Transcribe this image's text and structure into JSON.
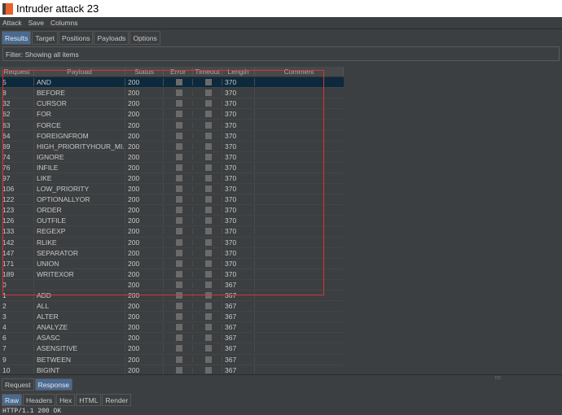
{
  "title": "Intruder attack 23",
  "menu": [
    "Attack",
    "Save",
    "Columns"
  ],
  "tabs": [
    "Results",
    "Target",
    "Positions",
    "Payloads",
    "Options"
  ],
  "filter": "Filter: Showing all items",
  "columns": [
    "Request",
    "Payload",
    "Status",
    "Error",
    "Timeout",
    "Length",
    "Comment"
  ],
  "rows": [
    [
      "5",
      "AND",
      "200",
      "370"
    ],
    [
      "8",
      "BEFORE",
      "200",
      "370"
    ],
    [
      "32",
      "CURSOR",
      "200",
      "370"
    ],
    [
      "62",
      "FOR",
      "200",
      "370"
    ],
    [
      "63",
      "FORCE",
      "200",
      "370"
    ],
    [
      "64",
      "FOREIGNFROM",
      "200",
      "370"
    ],
    [
      "69",
      "HIGH_PRIORITYHOUR_MI...",
      "200",
      "370"
    ],
    [
      "74",
      "IGNORE",
      "200",
      "370"
    ],
    [
      "76",
      "INFILE",
      "200",
      "370"
    ],
    [
      "97",
      "LIKE",
      "200",
      "370"
    ],
    [
      "106",
      "LOW_PRIORITY",
      "200",
      "370"
    ],
    [
      "122",
      "OPTIONALLYOR",
      "200",
      "370"
    ],
    [
      "123",
      "ORDER",
      "200",
      "370"
    ],
    [
      "126",
      "OUTFILE",
      "200",
      "370"
    ],
    [
      "133",
      "REGEXP",
      "200",
      "370"
    ],
    [
      "142",
      "RLIKE",
      "200",
      "370"
    ],
    [
      "147",
      "SEPARATOR",
      "200",
      "370"
    ],
    [
      "171",
      "UNION",
      "200",
      "370"
    ],
    [
      "189",
      "WRITEXOR",
      "200",
      "370"
    ],
    [
      "0",
      "",
      "200",
      "367"
    ],
    [
      "1",
      "ADD",
      "200",
      "367"
    ],
    [
      "2",
      "ALL",
      "200",
      "367"
    ],
    [
      "3",
      "ALTER",
      "200",
      "367"
    ],
    [
      "4",
      "ANALYZE",
      "200",
      "367"
    ],
    [
      "6",
      "ASASC",
      "200",
      "367"
    ],
    [
      "7",
      "ASENSITIVE",
      "200",
      "367"
    ],
    [
      "9",
      "BETWEEN",
      "200",
      "367"
    ],
    [
      "10",
      "BIGINT",
      "200",
      "367"
    ]
  ],
  "msg_tabs": [
    "Request",
    "Response"
  ],
  "view_tabs": [
    "Raw",
    "Headers",
    "Hex",
    "HTML",
    "Render"
  ],
  "response_text": "HTTP/1.1 200 OK"
}
